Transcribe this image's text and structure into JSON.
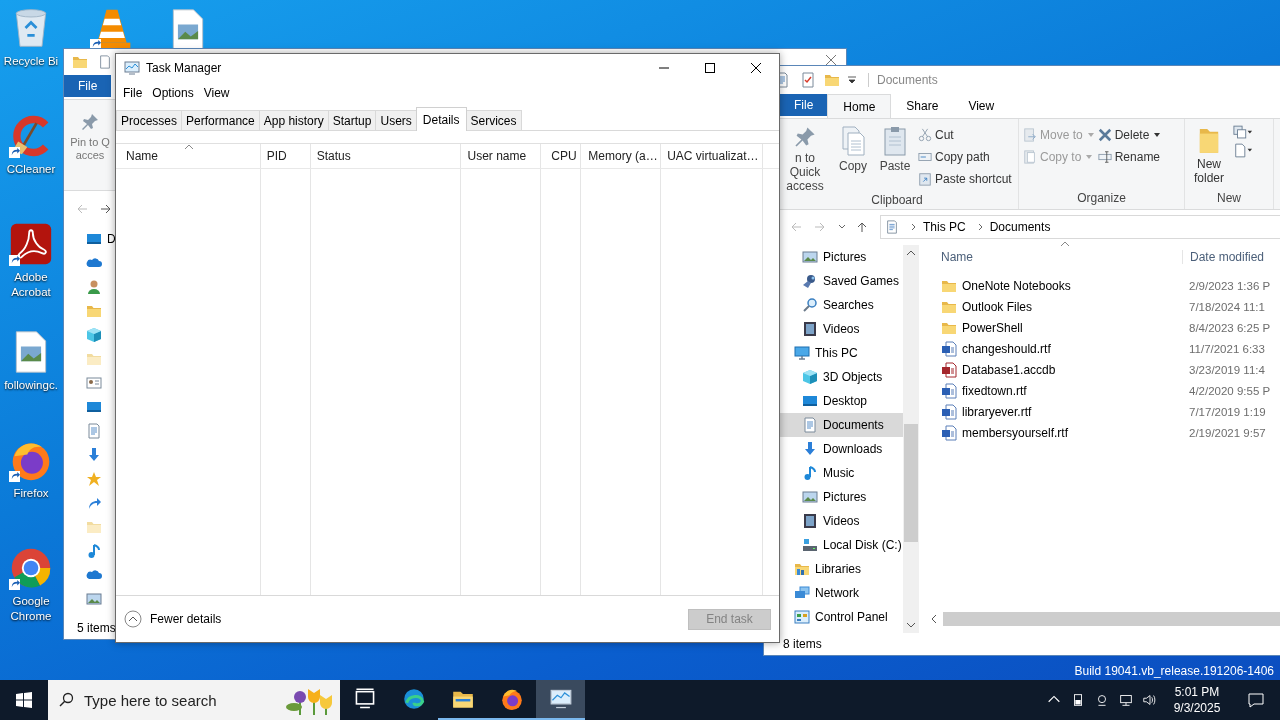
{
  "desktop": {
    "icons": [
      {
        "kind": "recycle",
        "label": "Recycle Bi",
        "shortcut": false
      },
      {
        "kind": "ccleaner",
        "label": "CCleaner",
        "shortcut": true
      },
      {
        "kind": "acrobat",
        "label": "Adobe Acrobat",
        "shortcut": true
      },
      {
        "kind": "image",
        "label": "followingc.",
        "shortcut": false
      },
      {
        "kind": "firefox",
        "label": "Firefox",
        "shortcut": true
      },
      {
        "kind": "chrome",
        "label": "Google Chrome",
        "shortcut": true
      }
    ],
    "build_text": "Build 19041.vb_release.191206-1406"
  },
  "back_window": {
    "file_tab": "File",
    "pin_label": "Pin to Q acces",
    "nav_items": [
      {
        "kind": "desktop",
        "label": "D"
      },
      {
        "kind": "cloud"
      },
      {
        "kind": "user"
      },
      {
        "kind": "folder"
      },
      {
        "kind": "cube"
      },
      {
        "kind": "pale"
      },
      {
        "kind": "contact"
      },
      {
        "kind": "desktop"
      },
      {
        "kind": "documents"
      },
      {
        "kind": "downloads"
      },
      {
        "kind": "star"
      },
      {
        "kind": "arrow"
      },
      {
        "kind": "pale"
      },
      {
        "kind": "music"
      },
      {
        "kind": "cloud"
      },
      {
        "kind": "pictures"
      }
    ],
    "status": "5 items"
  },
  "task_manager": {
    "title": "Task Manager",
    "menu": [
      "File",
      "Options",
      "View"
    ],
    "tabs": [
      {
        "label": "Processes",
        "selected": false
      },
      {
        "label": "Performance",
        "selected": false
      },
      {
        "label": "App history",
        "selected": false
      },
      {
        "label": "Startup",
        "selected": false
      },
      {
        "label": "Users",
        "selected": false
      },
      {
        "label": "Details",
        "selected": true
      },
      {
        "label": "Services",
        "selected": false
      }
    ],
    "columns": [
      "Name",
      "PID",
      "Status",
      "User name",
      "CPU",
      "Memory (a…",
      "UAC virtualizat…"
    ],
    "fewer_details": "Fewer details",
    "end_task": {
      "label": "End task",
      "disabled": true
    }
  },
  "explorer": {
    "title": "Documents",
    "file_tab": "File",
    "ribbon_tabs": [
      {
        "label": "Home",
        "selected": true
      },
      {
        "label": "Share",
        "selected": false
      },
      {
        "label": "View",
        "selected": false
      }
    ],
    "clipboard": {
      "pin": "n to Quick access",
      "copy": "Copy",
      "paste": "Paste",
      "cut": "Cut",
      "copy_path": "Copy path",
      "paste_shortcut": "Paste shortcut",
      "label": "Clipboard"
    },
    "organize": {
      "move_to": {
        "label": "Move to",
        "disabled": true
      },
      "copy_to": {
        "label": "Copy to",
        "disabled": true
      },
      "delete": {
        "label": "Delete",
        "disabled": false
      },
      "rename": {
        "label": "Rename",
        "disabled": false
      },
      "label": "Organize"
    },
    "new": {
      "new_folder": "New folder",
      "label": "New"
    },
    "address": [
      "This PC",
      "Documents"
    ],
    "nav_tree": [
      {
        "children": [
          {
            "kind": "pictures",
            "label": "Pictures",
            "selected": false
          },
          {
            "kind": "games",
            "label": "Saved Games",
            "selected": false
          },
          {
            "kind": "searches",
            "label": "Searches",
            "selected": false
          },
          {
            "kind": "videos",
            "label": "Videos",
            "selected": false
          }
        ]
      },
      {
        "kind": "pc",
        "label": "This PC",
        "selected": false,
        "children": [
          {
            "kind": "cube",
            "label": "3D Objects",
            "selected": false
          },
          {
            "kind": "desktop",
            "label": "Desktop",
            "selected": false
          },
          {
            "kind": "documents",
            "label": "Documents",
            "selected": true
          },
          {
            "kind": "downloads",
            "label": "Downloads",
            "selected": false
          },
          {
            "kind": "music",
            "label": "Music",
            "selected": false
          },
          {
            "kind": "pictures",
            "label": "Pictures",
            "selected": false
          },
          {
            "kind": "videos",
            "label": "Videos",
            "selected": false
          },
          {
            "kind": "disk",
            "label": "Local Disk (C:)",
            "selected": false
          }
        ]
      },
      {
        "kind": "libraries",
        "label": "Libraries",
        "selected": false
      },
      {
        "kind": "network",
        "label": "Network",
        "selected": false
      },
      {
        "kind": "control",
        "label": "Control Panel",
        "selected": false
      }
    ],
    "columns": [
      "Name",
      "Date modified"
    ],
    "files": [
      {
        "kind": "folder",
        "name": "OneNote Notebooks",
        "date": "2/9/2023 1:36 P"
      },
      {
        "kind": "folder",
        "name": "Outlook Files",
        "date": "7/18/2024 11:1"
      },
      {
        "kind": "folder",
        "name": "PowerShell",
        "date": "8/4/2023 6:25 P"
      },
      {
        "kind": "word",
        "name": "changeshould.rtf",
        "date": "11/7/2021 6:33"
      },
      {
        "kind": "access",
        "name": "Database1.accdb",
        "date": "3/23/2019 11:4"
      },
      {
        "kind": "word",
        "name": "fixedtown.rtf",
        "date": "4/2/2020 9:55 P"
      },
      {
        "kind": "word",
        "name": "libraryever.rtf",
        "date": "7/17/2019 1:19"
      },
      {
        "kind": "word",
        "name": "membersyourself.rtf",
        "date": "2/19/2021 9:57"
      }
    ],
    "status": "8 items"
  },
  "taskbar": {
    "search_placeholder": "Type here to search",
    "apps": [
      {
        "kind": "taskview",
        "running": false,
        "selected": false
      },
      {
        "kind": "edge",
        "running": false,
        "selected": false
      },
      {
        "kind": "explorer",
        "running": true,
        "selected": false
      },
      {
        "kind": "firefox",
        "running": true,
        "selected": false
      },
      {
        "kind": "taskmgr",
        "running": true,
        "selected": true
      }
    ],
    "time": "5:01 PM",
    "date": "9/3/2025"
  }
}
